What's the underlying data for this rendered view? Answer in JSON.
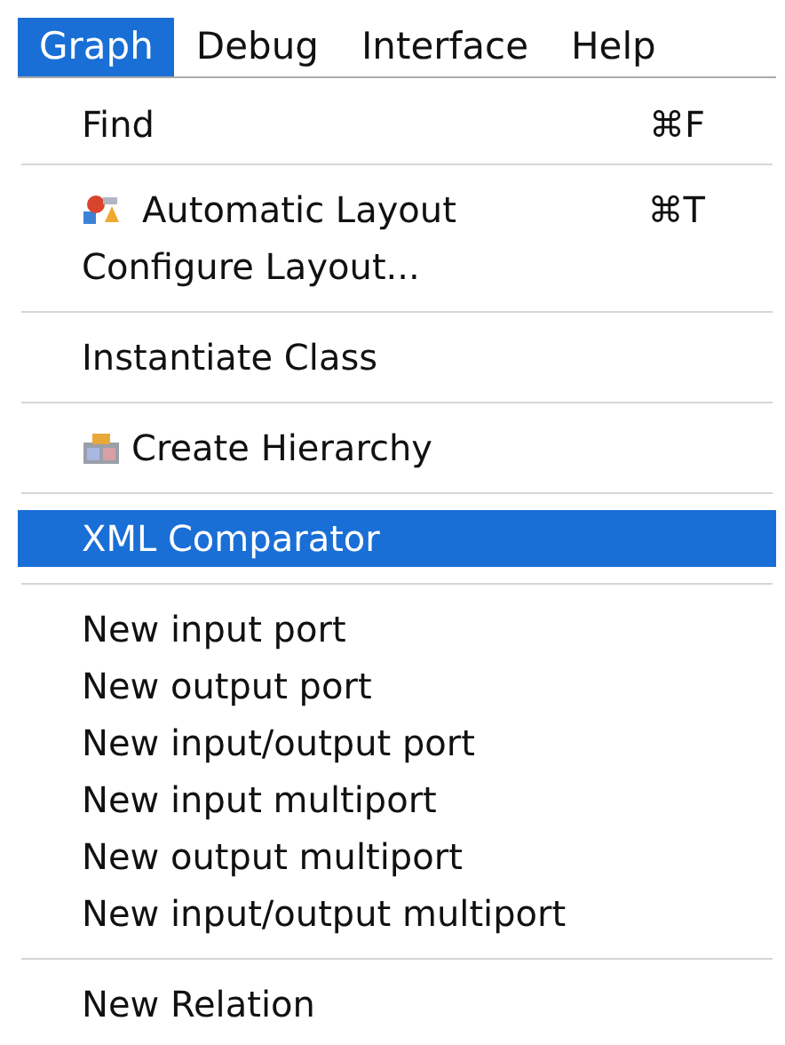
{
  "menu_bar": [
    {
      "label": "Graph",
      "selected": true
    },
    {
      "label": "Debug",
      "selected": false
    },
    {
      "label": "Interface",
      "selected": false
    },
    {
      "label": "Help",
      "selected": false
    }
  ],
  "menu": {
    "sections": [
      {
        "items": [
          {
            "kind": "text",
            "label": "Find",
            "shortcut": "⌘F",
            "selected": false
          }
        ]
      },
      {
        "items": [
          {
            "kind": "layout",
            "label": "Automatic Layout",
            "shortcut": "⌘T",
            "selected": false
          },
          {
            "kind": "text",
            "label": "Configure Layout...",
            "selected": false
          }
        ]
      },
      {
        "items": [
          {
            "kind": "text",
            "label": "Instantiate Class",
            "selected": false
          }
        ]
      },
      {
        "items": [
          {
            "kind": "hierarchy",
            "label": "Create Hierarchy",
            "selected": false
          }
        ]
      },
      {
        "items": [
          {
            "kind": "text",
            "label": "XML Comparator",
            "selected": true
          }
        ]
      },
      {
        "items": [
          {
            "kind": "text",
            "label": "New input port",
            "selected": false
          },
          {
            "kind": "text",
            "label": "New output port",
            "selected": false
          },
          {
            "kind": "text",
            "label": "New input/output port",
            "selected": false
          },
          {
            "kind": "text",
            "label": "New input multiport",
            "selected": false
          },
          {
            "kind": "text",
            "label": "New output multiport",
            "selected": false
          },
          {
            "kind": "text",
            "label": "New input/output multiport",
            "selected": false
          }
        ]
      },
      {
        "items": [
          {
            "kind": "text",
            "label": "New Relation",
            "selected": false
          }
        ]
      }
    ]
  }
}
